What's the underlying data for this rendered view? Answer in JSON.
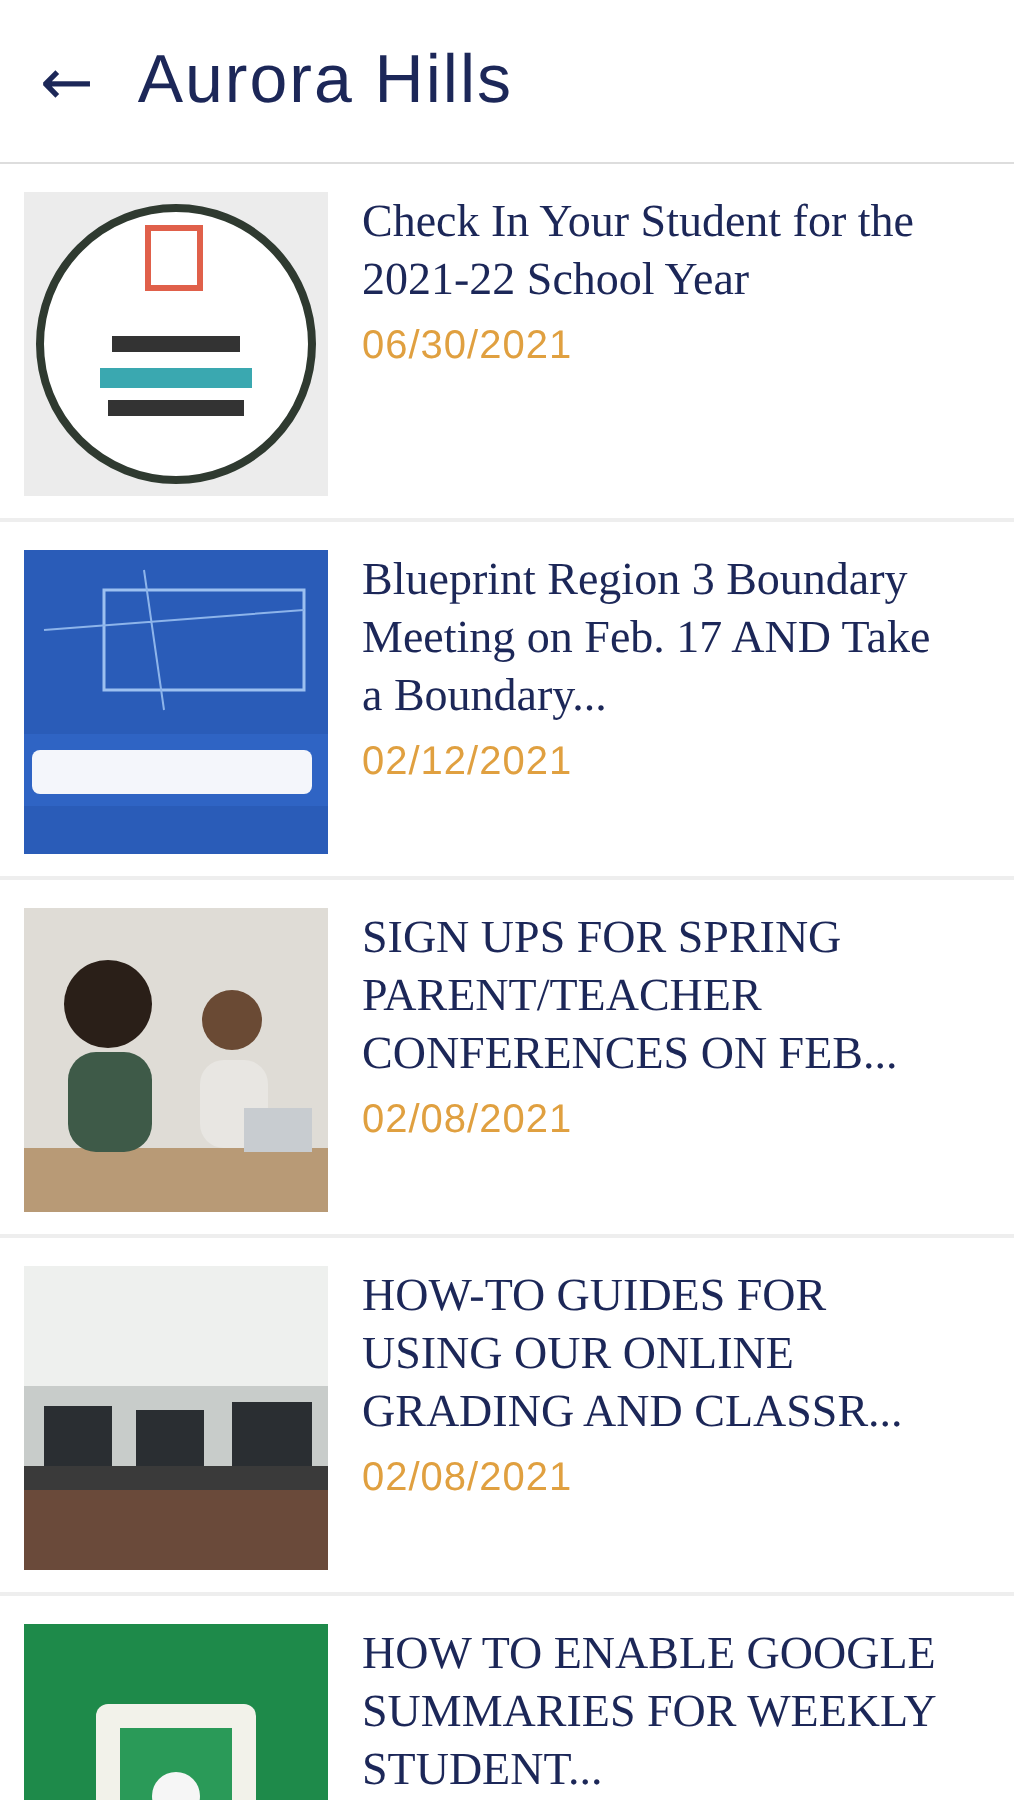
{
  "header": {
    "back_icon": "←",
    "title": "Aurora Hills"
  },
  "posts": [
    {
      "title": "Check In Your Student for the 2021-22 School Year",
      "date": "06/30/2021"
    },
    {
      "title": "Blueprint Region 3 Boundary Meeting on Feb. 17 AND Take a Boundary...",
      "date": "02/12/2021"
    },
    {
      "title": "SIGN UPS FOR SPRING PARENT/TEACHER CONFERENCES ON FEB...",
      "date": "02/08/2021"
    },
    {
      "title": "HOW-TO GUIDES FOR USING OUR ONLINE GRADING AND CLASSR...",
      "date": "02/08/2021"
    },
    {
      "title": "HOW TO ENABLE GOOGLE SUMMARIES FOR WEEKLY STUDENT..."
    }
  ]
}
